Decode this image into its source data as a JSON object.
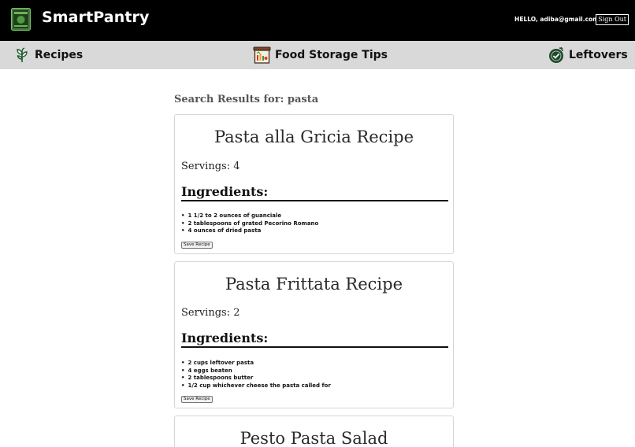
{
  "header": {
    "brand": "SmartPantry",
    "logo_icon": "pantry-logo-icon",
    "greeting": "HELLO, adiba@gmail.com",
    "signout_label": "Sign Out"
  },
  "nav": {
    "items": [
      {
        "label": "Recipes",
        "icon": "herb-icon"
      },
      {
        "label": "Food Storage Tips",
        "icon": "storage-box-icon"
      },
      {
        "label": "Leftovers",
        "icon": "leftovers-plate-icon"
      }
    ]
  },
  "search": {
    "heading": "Search Results for: pasta"
  },
  "recipes": [
    {
      "title": "Pasta alla Gricia Recipe",
      "servings": "Servings: 4",
      "ingredients_heading": "Ingredients:",
      "ingredients": [
        "1 1/2 to 2 ounces of guanciale",
        "2 tablespoons of grated Pecorino Romano",
        "4 ounces of dried pasta"
      ],
      "save_label": "Save Recipe"
    },
    {
      "title": "Pasta Frittata Recipe",
      "servings": "Servings: 2",
      "ingredients_heading": "Ingredients:",
      "ingredients": [
        "2 cups leftover pasta",
        "4 eggs beaten",
        "2 tablespoons butter",
        "1/2 cup whichever cheese the pasta called for"
      ],
      "save_label": "Save Recipe"
    },
    {
      "title": "Pesto Pasta Salad"
    }
  ],
  "colors": {
    "header_bg": "#000000",
    "nav_bg": "#d9d9d9",
    "logo_green": "#2e7d32"
  }
}
